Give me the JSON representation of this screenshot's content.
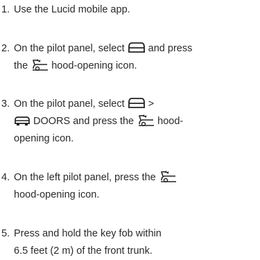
{
  "steps": [
    {
      "number": "1.",
      "text": "Use the Lucid mobile app."
    },
    {
      "number": "2.",
      "part1": "On the pilot panel, select",
      "part2": "and press",
      "part3": "the",
      "part4": "hood-opening icon."
    },
    {
      "number": "3.",
      "part1": "On the pilot panel, select",
      "part2": ">",
      "part3": "DOORS and press the",
      "part4": "hood-",
      "part5": "opening icon."
    },
    {
      "number": "4.",
      "part1": "On the left pilot panel, press the",
      "part2": "hood-opening icon."
    },
    {
      "number": "5.",
      "line1": "Press and hold the key fob within",
      "line2": "6.5 feet (2 m) of the front trunk."
    }
  ],
  "icons": {
    "vehicle": "car-outline-icon",
    "doors": "car-doors-icon",
    "hood": "hood-opening-icon"
  },
  "colors": {
    "text": "#2a2a2a"
  }
}
